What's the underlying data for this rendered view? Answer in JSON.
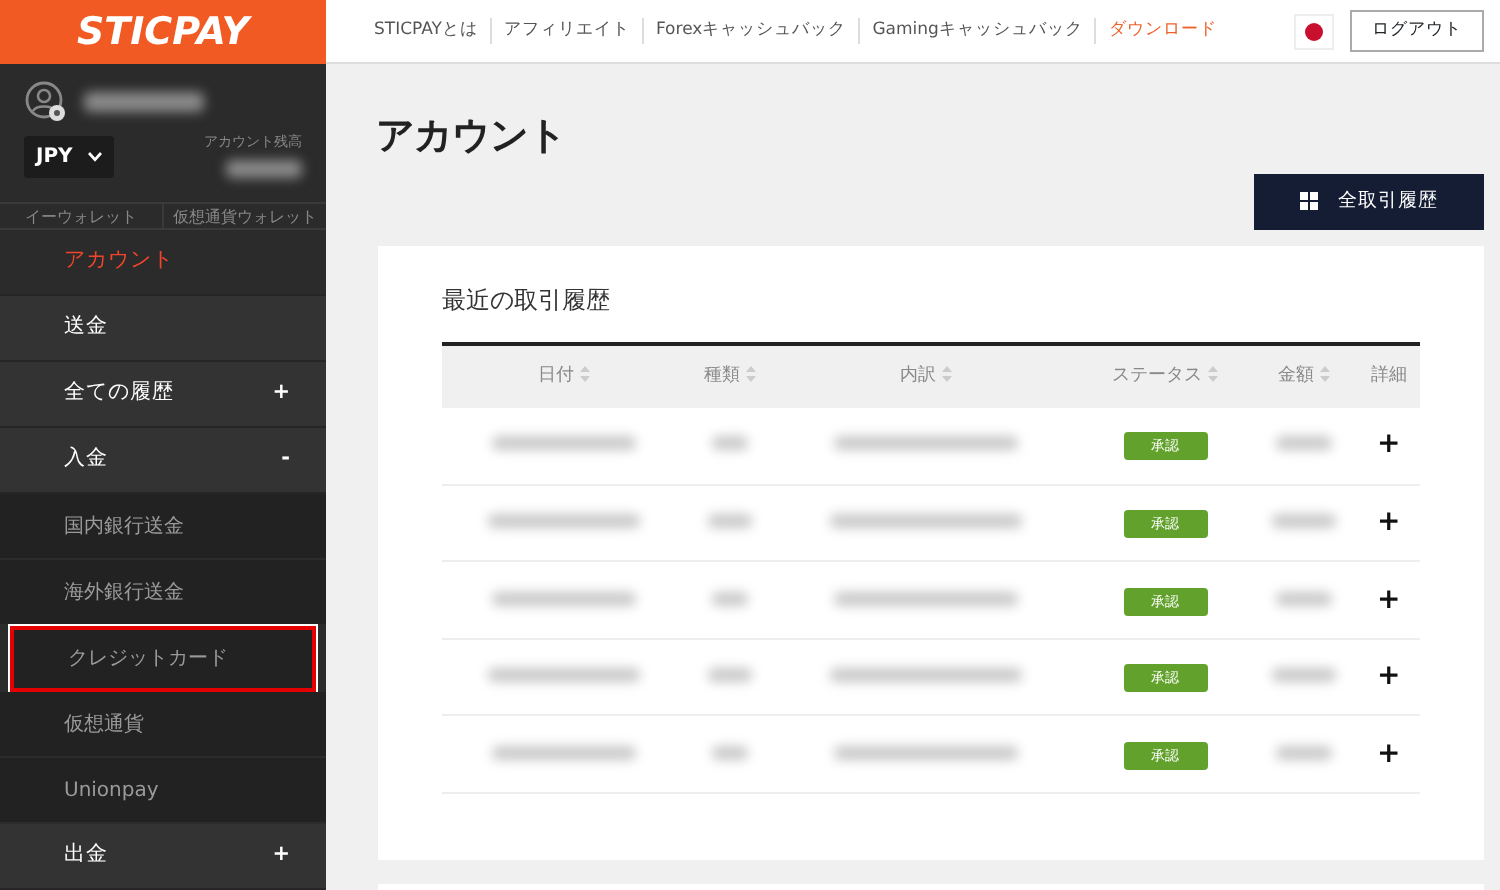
{
  "logo": "STICPAY",
  "top_nav": [
    {
      "label": "STICPAYとは",
      "highlighted": false
    },
    {
      "label": "アフィリエイト",
      "highlighted": false
    },
    {
      "label": "Forexキャッシュバック",
      "highlighted": false
    },
    {
      "label": "Gamingキャッシュバック",
      "highlighted": false
    },
    {
      "label": "ダウンロード",
      "highlighted": true
    }
  ],
  "logout_button": "ログアウト",
  "sidebar": {
    "balance_label": "アカウント残高",
    "currency": "JPY",
    "wallet_tabs": [
      "イーウォレット",
      "仮想通貨ウォレット"
    ],
    "items": [
      {
        "kind": "item",
        "label": "アカウント",
        "selected": true,
        "highlighted": false
      },
      {
        "kind": "item",
        "label": "送金",
        "selected": false,
        "highlighted": false
      },
      {
        "kind": "item",
        "label": "全ての履歴",
        "selected": false,
        "toggle": "+",
        "highlighted": false
      },
      {
        "kind": "item",
        "label": "入金",
        "selected": false,
        "toggle": "-",
        "highlighted": false
      },
      {
        "kind": "sub",
        "label": "国内銀行送金",
        "selected": false,
        "highlighted": false
      },
      {
        "kind": "sub",
        "label": "海外銀行送金",
        "selected": false,
        "highlighted": false
      },
      {
        "kind": "sub",
        "label": "クレジットカード",
        "selected": false,
        "highlighted": true
      },
      {
        "kind": "sub",
        "label": "仮想通貨",
        "selected": false,
        "highlighted": false
      },
      {
        "kind": "sub",
        "label": "Unionpay",
        "selected": false,
        "highlighted": false
      },
      {
        "kind": "item",
        "label": "出金",
        "selected": false,
        "toggle": "+",
        "highlighted": false
      }
    ]
  },
  "page_title": "アカウント",
  "all_history_button": "全取引履歴",
  "card": {
    "title": "最近の取引履歴",
    "columns": [
      {
        "label": "日付",
        "sortable": true
      },
      {
        "label": "種類",
        "sortable": true
      },
      {
        "label": "内訳",
        "sortable": true
      },
      {
        "label": "ステータス",
        "sortable": true
      },
      {
        "label": "金額",
        "sortable": true
      },
      {
        "label": "詳細",
        "sortable": false
      }
    ],
    "rows": [
      {
        "status": "承認",
        "detail": "+"
      },
      {
        "status": "承認",
        "detail": "+"
      },
      {
        "status": "承認",
        "detail": "+"
      },
      {
        "status": "承認",
        "detail": "+"
      },
      {
        "status": "承認",
        "detail": "+"
      }
    ]
  }
}
